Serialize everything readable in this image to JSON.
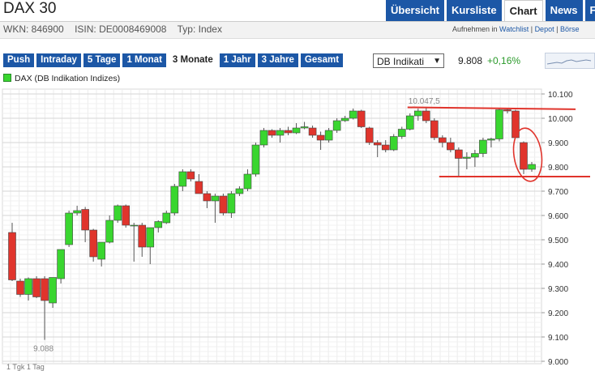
{
  "header": {
    "title": "DAX 30"
  },
  "top_tabs": [
    {
      "label": "Übersicht",
      "active": false
    },
    {
      "label": "Kursliste",
      "active": false
    },
    {
      "label": "Chart",
      "active": true
    },
    {
      "label": "News",
      "active": false
    },
    {
      "label": "Fo",
      "active": false
    }
  ],
  "info": {
    "wkn": "WKN: 846900",
    "isin": "ISIN: DE0008469008",
    "typ": "Typ: Index",
    "add_prefix": "Aufnehmen in ",
    "watchlist": "Watchlist",
    "sep1": " | ",
    "depot": "Depot",
    "sep2": " | ",
    "boerse": "Börse"
  },
  "ranges": [
    {
      "label": "Push",
      "active": false
    },
    {
      "label": "Intraday",
      "active": false
    },
    {
      "label": "5 Tage",
      "active": false
    },
    {
      "label": "1 Monat",
      "active": false
    },
    {
      "label": "3 Monate",
      "active": true
    },
    {
      "label": "1 Jahr",
      "active": false
    },
    {
      "label": "3 Jahre",
      "active": false
    },
    {
      "label": "Gesamt",
      "active": false
    }
  ],
  "exchange_select": {
    "value": "DB Indikati"
  },
  "quote": {
    "price": "9.808",
    "change": "+0,16%",
    "change_color": "#2a9a2a"
  },
  "legend": {
    "label": "DAX (DB Indikation Indizes)",
    "color": "#39d62f"
  },
  "bottom_note": "1 Tgk   1 Tag",
  "chart_data": {
    "type": "candlestick",
    "y_ticks": [
      "10.100",
      "10.000",
      "9.900",
      "9.800",
      "9.700",
      "9.600",
      "9.500",
      "9.400",
      "9.300",
      "9.200",
      "9.100",
      "9.000"
    ],
    "y_tick_values": [
      10100,
      10000,
      9900,
      9800,
      9700,
      9600,
      9500,
      9400,
      9300,
      9200,
      9100,
      9000
    ],
    "ylim": [
      8990,
      10120
    ],
    "up_color": "#39d62f",
    "down_color": "#e0342c",
    "annotation_color": "#e0342c",
    "low_label": "9.088",
    "high_label": "10.047,5",
    "candles": [
      {
        "o": 9530,
        "h": 9570,
        "l": 9330,
        "c": 9335
      },
      {
        "o": 9330,
        "h": 9340,
        "l": 9265,
        "c": 9275
      },
      {
        "o": 9275,
        "h": 9345,
        "l": 9250,
        "c": 9340
      },
      {
        "o": 9340,
        "h": 9350,
        "l": 9260,
        "c": 9265
      },
      {
        "o": 9340,
        "h": 9350,
        "l": 9088,
        "c": 9250
      },
      {
        "o": 9240,
        "h": 9300,
        "l": 9220,
        "c": 9345
      },
      {
        "o": 9340,
        "h": 9460,
        "l": 9320,
        "c": 9460
      },
      {
        "o": 9480,
        "h": 9620,
        "l": 9470,
        "c": 9610
      },
      {
        "o": 9610,
        "h": 9640,
        "l": 9600,
        "c": 9620
      },
      {
        "o": 9625,
        "h": 9635,
        "l": 9490,
        "c": 9540
      },
      {
        "o": 9540,
        "h": 9545,
        "l": 9410,
        "c": 9430
      },
      {
        "o": 9420,
        "h": 9480,
        "l": 9390,
        "c": 9490
      },
      {
        "o": 9490,
        "h": 9600,
        "l": 9485,
        "c": 9580
      },
      {
        "o": 9580,
        "h": 9645,
        "l": 9570,
        "c": 9640
      },
      {
        "o": 9640,
        "h": 9645,
        "l": 9550,
        "c": 9560
      },
      {
        "o": 9560,
        "h": 9570,
        "l": 9410,
        "c": 9560
      },
      {
        "o": 9560,
        "h": 9570,
        "l": 9430,
        "c": 9470
      },
      {
        "o": 9470,
        "h": 9480,
        "l": 9400,
        "c": 9550
      },
      {
        "o": 9550,
        "h": 9580,
        "l": 9530,
        "c": 9575
      },
      {
        "o": 9570,
        "h": 9620,
        "l": 9565,
        "c": 9610
      },
      {
        "o": 9610,
        "h": 9730,
        "l": 9600,
        "c": 9720
      },
      {
        "o": 9720,
        "h": 9790,
        "l": 9700,
        "c": 9780
      },
      {
        "o": 9780,
        "h": 9790,
        "l": 9740,
        "c": 9750
      },
      {
        "o": 9740,
        "h": 9770,
        "l": 9690,
        "c": 9690
      },
      {
        "o": 9690,
        "h": 9700,
        "l": 9630,
        "c": 9660
      },
      {
        "o": 9660,
        "h": 9690,
        "l": 9570,
        "c": 9680
      },
      {
        "o": 9680,
        "h": 9690,
        "l": 9600,
        "c": 9610
      },
      {
        "o": 9610,
        "h": 9700,
        "l": 9590,
        "c": 9690
      },
      {
        "o": 9690,
        "h": 9720,
        "l": 9680,
        "c": 9710
      },
      {
        "o": 9710,
        "h": 9790,
        "l": 9700,
        "c": 9770
      },
      {
        "o": 9770,
        "h": 9900,
        "l": 9760,
        "c": 9890
      },
      {
        "o": 9890,
        "h": 9960,
        "l": 9880,
        "c": 9950
      },
      {
        "o": 9950,
        "h": 9955,
        "l": 9920,
        "c": 9930
      },
      {
        "o": 9930,
        "h": 9960,
        "l": 9900,
        "c": 9950
      },
      {
        "o": 9950,
        "h": 9965,
        "l": 9930,
        "c": 9940
      },
      {
        "o": 9940,
        "h": 9980,
        "l": 9935,
        "c": 9960
      },
      {
        "o": 9960,
        "h": 9985,
        "l": 9955,
        "c": 9965
      },
      {
        "o": 9960,
        "h": 9970,
        "l": 9920,
        "c": 9930
      },
      {
        "o": 9930,
        "h": 9945,
        "l": 9870,
        "c": 9910
      },
      {
        "o": 9910,
        "h": 9960,
        "l": 9900,
        "c": 9950
      },
      {
        "o": 9950,
        "h": 10000,
        "l": 9940,
        "c": 9990
      },
      {
        "o": 9990,
        "h": 10010,
        "l": 9985,
        "c": 10000
      },
      {
        "o": 10000,
        "h": 10040,
        "l": 9995,
        "c": 10030
      },
      {
        "o": 10030,
        "h": 10035,
        "l": 9960,
        "c": 9965
      },
      {
        "o": 9960,
        "h": 9965,
        "l": 9890,
        "c": 9900
      },
      {
        "o": 9900,
        "h": 9910,
        "l": 9840,
        "c": 9890
      },
      {
        "o": 9890,
        "h": 9910,
        "l": 9860,
        "c": 9870
      },
      {
        "o": 9870,
        "h": 9935,
        "l": 9865,
        "c": 9925
      },
      {
        "o": 9925,
        "h": 9965,
        "l": 9915,
        "c": 9955
      },
      {
        "o": 9955,
        "h": 10020,
        "l": 9950,
        "c": 10010
      },
      {
        "o": 10010,
        "h": 10040,
        "l": 9990,
        "c": 10030
      },
      {
        "o": 10030,
        "h": 10047,
        "l": 9980,
        "c": 9990
      },
      {
        "o": 9990,
        "h": 10000,
        "l": 9910,
        "c": 9920
      },
      {
        "o": 9920,
        "h": 9930,
        "l": 9880,
        "c": 9900
      },
      {
        "o": 9900,
        "h": 9920,
        "l": 9860,
        "c": 9870
      },
      {
        "o": 9870,
        "h": 9880,
        "l": 9760,
        "c": 9835
      },
      {
        "o": 9835,
        "h": 9860,
        "l": 9790,
        "c": 9840
      },
      {
        "o": 9840,
        "h": 9870,
        "l": 9800,
        "c": 9855
      },
      {
        "o": 9855,
        "h": 9920,
        "l": 9840,
        "c": 9910
      },
      {
        "o": 9910,
        "h": 9920,
        "l": 9880,
        "c": 9915
      },
      {
        "o": 9915,
        "h": 10040,
        "l": 9905,
        "c": 10035
      },
      {
        "o": 10035,
        "h": 10040,
        "l": 10020,
        "c": 10030
      },
      {
        "o": 10030,
        "h": 10035,
        "l": 9920,
        "c": 9920
      },
      {
        "o": 9900,
        "h": 9905,
        "l": 9770,
        "c": 9790
      },
      {
        "o": 9790,
        "h": 9820,
        "l": 9780,
        "c": 9810
      }
    ]
  }
}
